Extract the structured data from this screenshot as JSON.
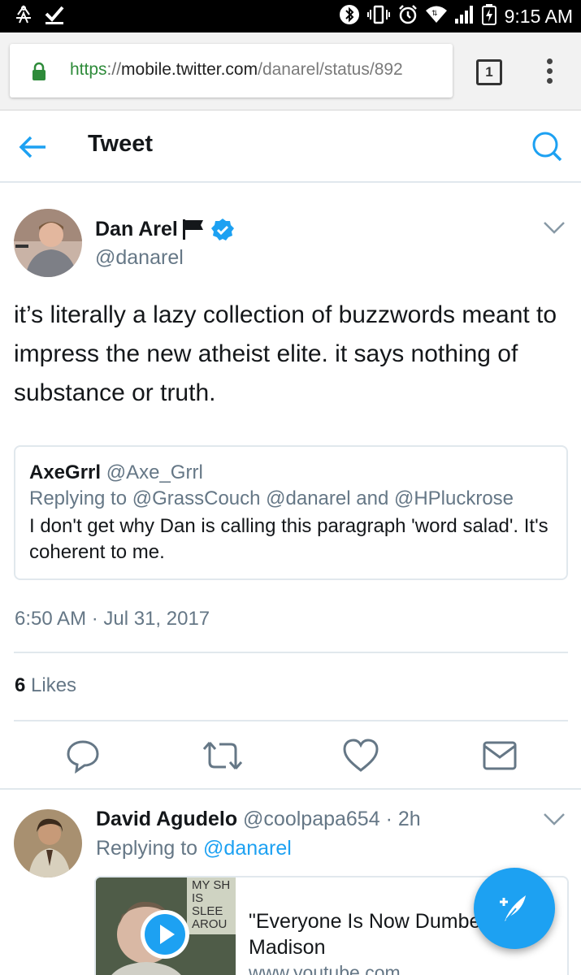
{
  "status_bar": {
    "time": "9:15 AM",
    "icons": [
      "accessibility-icon",
      "download-complete-icon",
      "bluetooth-icon",
      "vibrate-icon",
      "alarm-icon",
      "wifi-icon",
      "signal-icon",
      "battery-charging-icon"
    ]
  },
  "browser": {
    "url_scheme": "https",
    "url_sep": "://",
    "url_host": "mobile.twitter.com",
    "url_path": "/danarel/status/892",
    "tab_count": "1",
    "colors": {
      "lock": "#2e8b3a",
      "scheme": "#2e8b3a"
    }
  },
  "header": {
    "title": "Tweet"
  },
  "tweet": {
    "author_name": "Dan Arel",
    "author_handle": "@danarel",
    "text": "it’s literally a lazy collection of buzzwords meant to impress the new atheist elite. it says nothing of substance or truth.",
    "quote": {
      "name": "AxeGrrl",
      "handle": "@Axe_Grrl",
      "reply": "Replying to @GrassCouch @danarel and @HPluckrose",
      "text": "I don't get why Dan is calling this paragraph 'word salad'. It's coherent to me."
    },
    "timestamp": "6:50 AM · Jul 31, 2017",
    "likes_count": "6",
    "likes_label": "Likes"
  },
  "reply": {
    "name": "David Agudelo",
    "handle": "@coolpapa654",
    "time": "· 2h",
    "replying_prefix": "Replying to",
    "replying_to": "@danarel",
    "card": {
      "thumb_text": "MY SH IS SLEE AROU",
      "title": "\"Everyone Is Now Dumber Madison",
      "domain": "www.youtube.com"
    }
  },
  "colors": {
    "accent": "#1da1f2",
    "secondary_text": "#657786",
    "divider": "#e1e8ed"
  }
}
